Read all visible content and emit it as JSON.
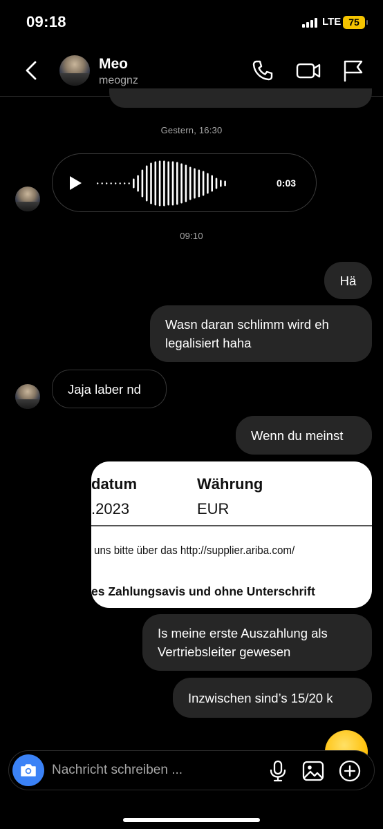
{
  "status_bar": {
    "time": "09:18",
    "network": "LTE",
    "battery": "75"
  },
  "header": {
    "name": "Meo",
    "handle": "meognz"
  },
  "timestamps": {
    "first": "Gestern, 16:30",
    "second": "09:10"
  },
  "voice_message": {
    "duration": "0:03"
  },
  "messages": [
    {
      "direction": "out",
      "text": "Hä"
    },
    {
      "direction": "out",
      "text": "Wasn daran schlimm wird eh legalisiert haha"
    },
    {
      "direction": "in",
      "text": "Jaja laber nd"
    },
    {
      "direction": "out",
      "text": "Wenn du meinst"
    },
    {
      "direction": "out",
      "text": "Is meine erste Auszahlung als Vertriebsleiter gewesen"
    },
    {
      "direction": "out",
      "text": "Inzwischen sind’s 15/20 k"
    }
  ],
  "attachment": {
    "col1_header": "datum",
    "col2_header": "Währung",
    "col1_value": ".2023",
    "col2_value": "EUR",
    "line1": "uns bitte über das http://supplier.ariba.com/",
    "line2": "es Zahlungsavis und ohne Unterschrift"
  },
  "composer": {
    "placeholder": "Nachricht schreiben ..."
  },
  "icons": [
    "back-icon",
    "phone-icon",
    "video-icon",
    "flag-icon",
    "play-icon",
    "camera-icon",
    "microphone-icon",
    "gallery-icon",
    "add-icon"
  ]
}
